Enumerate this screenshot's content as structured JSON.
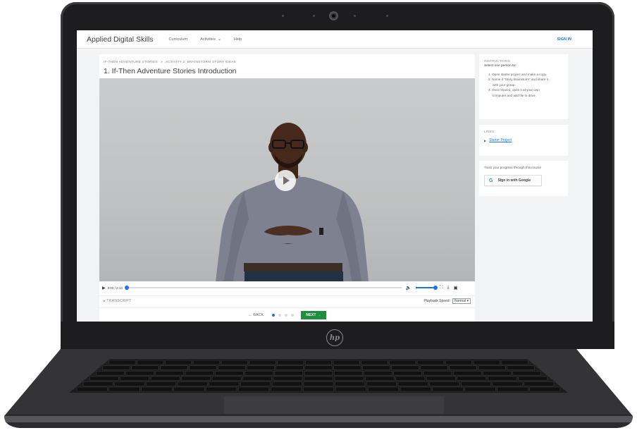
{
  "nav": {
    "brand": "Applied Digital Skills",
    "links": [
      "Curriculum",
      "Activities",
      "Help"
    ],
    "signin": "SIGN IN"
  },
  "breadcrumb": {
    "course": "IF-THEN ADVENTURE STORIES",
    "separator": ">",
    "activity": "ACTIVITY 2: BRAINSTORM STORY IDEAS"
  },
  "lesson_title": "1. If-Then Adventure Stories Introduction",
  "player": {
    "time": "0:00 / 2:14",
    "progress": 0.0
  },
  "transcript_label": "TRANSCRIPT",
  "speed": {
    "label": "Playback Speed:",
    "value": "Normal"
  },
  "pager": {
    "back": "BACK",
    "next": "NEXT",
    "dots_total": 4,
    "current": 1
  },
  "instructions": {
    "heading": "INSTRUCTIONS",
    "subheading": "Select one person to:",
    "steps": [
      "1. Open starter project and make a copy.",
      "2. Name it \"Story Brainstorm\" and share it",
      "with your group.",
      "3. Once shared, open it at your own",
      "computer and add file to drive."
    ]
  },
  "links": {
    "heading": "LINKS",
    "items": [
      "Starter Project"
    ]
  },
  "progress_card": {
    "text": "Track your progress through this course",
    "button": "Sign in with Google",
    "g": "G"
  },
  "device": {
    "logo": "hp"
  },
  "colors": {
    "accent": "#1a73e8",
    "next": "#1e8e3e",
    "bezel": "#1d1d1f"
  }
}
